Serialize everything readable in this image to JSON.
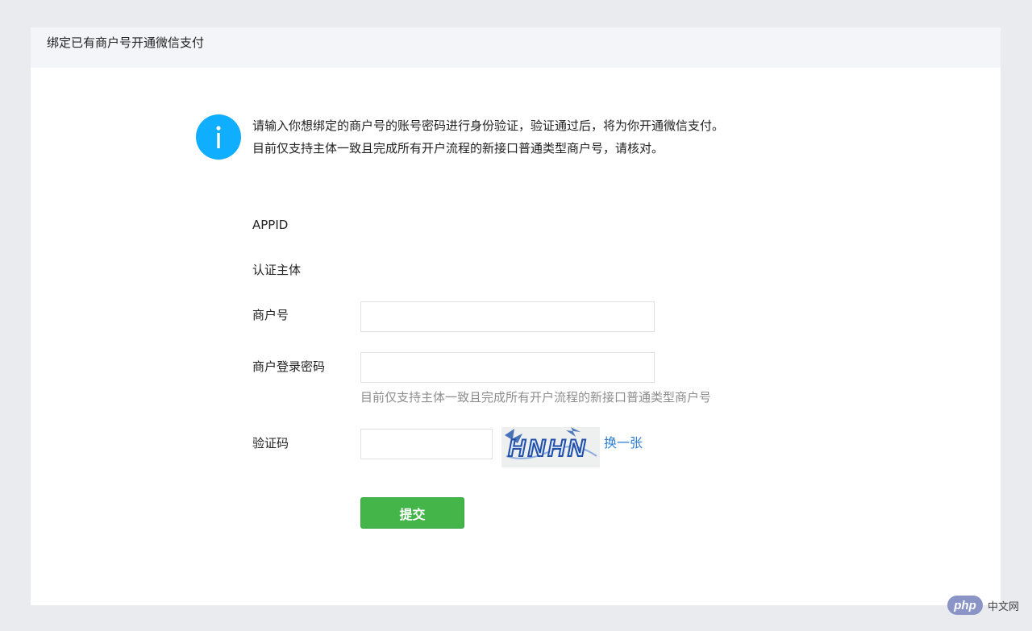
{
  "panel": {
    "title": "绑定已有商户号开通微信支付"
  },
  "notice": {
    "icon": "info-icon",
    "icon_color": "#10aeff",
    "line1": "请输入你想绑定的商户号的账号密码进行身份验证，验证通过后，将为你开通微信支付。",
    "line2": "目前仅支持主体一致且完成所有开户流程的新接口普通类型商户号，请核对。"
  },
  "form": {
    "appid_label": "APPID",
    "subject_label": "认证主体",
    "merchant_id_label": "商户号",
    "merchant_id_value": "",
    "password_label": "商户登录密码",
    "password_value": "",
    "password_hint": "目前仅支持主体一致且完成所有开户流程的新接口普通类型商户号",
    "captcha_label": "验证码",
    "captcha_value": "",
    "captcha_image_text": "HNHN",
    "refresh_label": "换一张",
    "submit_label": "提交",
    "submit_color": "#43b549",
    "link_color": "#2f7fd4"
  },
  "watermark": {
    "badge": "php",
    "text": "中文网"
  }
}
